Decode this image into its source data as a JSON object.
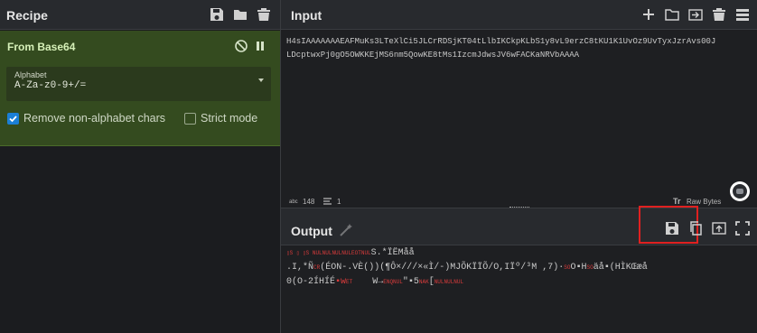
{
  "recipe": {
    "title": "Recipe",
    "operation": {
      "name": "From Base64",
      "alphabet_label": "Alphabet",
      "alphabet_value": "A-Za-z0-9+/=",
      "remove_non_alphabet_label": "Remove non-alphabet chars",
      "remove_non_alphabet_checked": true,
      "strict_mode_label": "Strict mode",
      "strict_mode_checked": false
    }
  },
  "input": {
    "title": "Input",
    "line1": "H4sIAAAAAAAEAFMuKs3LTeXlCi5JLCrRDSjKT04tLlbIKCkpKLbS1y8vL9erzC8tKU1K1UvOz9UvTyxJzrAvs00J",
    "line2": "LDcptwxPj0gO5OWKKEjMS6nm5QowKE8tMs1IzcmJdwsJV6wFACKaNRVbAAAA",
    "status_chars_icon": "abc",
    "status_chars": "148",
    "status_lines": "1",
    "raw_bytes_label": "Raw Bytes"
  },
  "output": {
    "title": "Output",
    "line1_red": "▯S ▯ ▯S NULNULNULNULEOTNUL",
    "line1_rest": "S.*ÏËMåå",
    "line2a": ".I,*Ñ",
    "line2_red1": "CR",
    "line2b": "(ÉON-.VÈ())(¶Ô×///×«Ì/-)MJÕKÏÏÕ/O,IÏº/³M ,7)·",
    "line2_red2": "SO",
    "line2c": "O▪H",
    "line2_red3": "SO",
    "line2d": "äå▪(HÌKŒæå",
    "line3a": "0(O-2ÍHÍÉ",
    "line3_red1": "▪w",
    "line3_red2": "ET",
    "line3b": "W→",
    "line3_red3": "ENQNUL",
    "line3c": "\"▪5",
    "line3_red4": "NAK",
    "line3d": "[",
    "line3_red5": "NULNULNUL"
  }
}
